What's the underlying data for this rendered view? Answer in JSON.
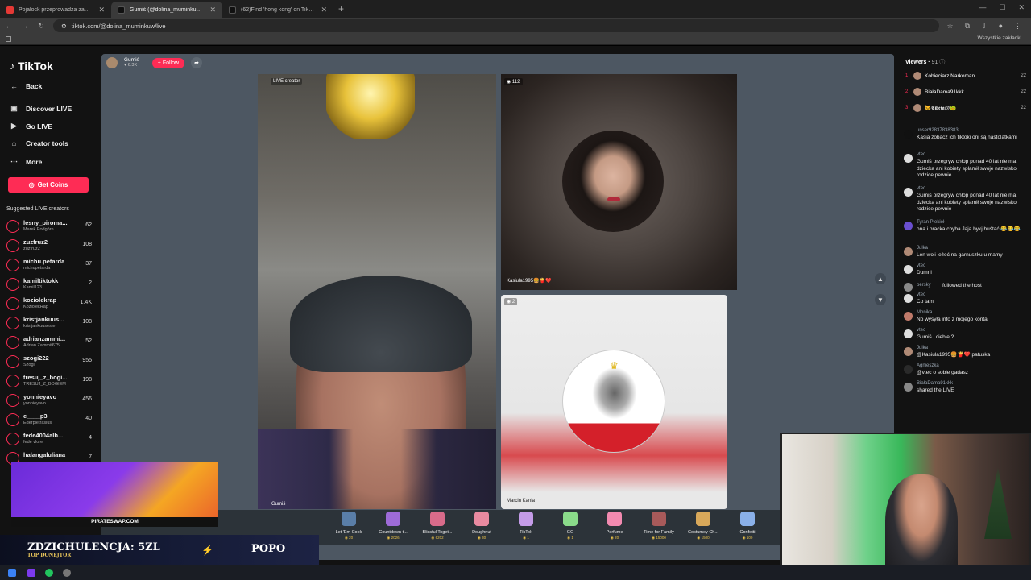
{
  "browser": {
    "tabs": [
      {
        "title": "Pojalock przeprowadza zamach",
        "color": "#e53935",
        "active": false
      },
      {
        "title": "Gumiś (@dolina_muminkuw) - TikTok LIVE",
        "color": "#111111",
        "active": true
      },
      {
        "title": "(62)Find 'hong kong' on TikTok",
        "color": "#111111",
        "active": false
      }
    ],
    "new_tab": "+",
    "url": "tiktok.com/@dolina_muminkuw/live",
    "all_bookmarks": "Wszystkie zakładki"
  },
  "sidebar": {
    "logo": "TikTok",
    "nav": [
      {
        "label": "Back",
        "icon": "back-arrow-icon",
        "glyph": "←"
      },
      {
        "label": "Discover LIVE",
        "icon": "live-tv-icon",
        "glyph": "▣"
      },
      {
        "label": "Go LIVE",
        "icon": "camera-icon",
        "glyph": "▶"
      },
      {
        "label": "Creator tools",
        "icon": "home-icon",
        "glyph": "⌂"
      },
      {
        "label": "More",
        "icon": "more-icon",
        "glyph": "⋯"
      }
    ],
    "get_coins": "Get Coins",
    "suggested_title": "Suggested LIVE creators",
    "creators": [
      {
        "name": "lesny_piroma...",
        "sub": "Marek Podgórn...",
        "count": "62"
      },
      {
        "name": "zuzfruz2",
        "sub": "zuzfruz2",
        "count": "108"
      },
      {
        "name": "michu.petarda",
        "sub": "michupetarda",
        "count": "37"
      },
      {
        "name": "kamiltiktokk",
        "sub": "Kamil123",
        "count": "2"
      },
      {
        "name": "koziolekrap",
        "sub": "KoziolekRap",
        "count": "1.4K"
      },
      {
        "name": "kristjankuus...",
        "sub": "kristjankuuseste",
        "count": "108"
      },
      {
        "name": "adrianzammi...",
        "sub": "Adrian Zammit675",
        "count": "52"
      },
      {
        "name": "szogi222",
        "sub": "Szogi",
        "count": "955"
      },
      {
        "name": "tresuj_z_bogi...",
        "sub": "TRESUJ_Z_BOGIEM",
        "count": "198"
      },
      {
        "name": "yonnieyavo",
        "sub": "yonnieyavo",
        "count": "456"
      },
      {
        "name": "e____p3",
        "sub": "Ederpietrasius",
        "count": "40"
      },
      {
        "name": "fede4004alb...",
        "sub": "fede vlore",
        "count": "4"
      },
      {
        "name": "halangaluliana",
        "sub": "",
        "count": "7"
      }
    ]
  },
  "host": {
    "name": "Gumiś",
    "likes": "6.3K",
    "follow_label": "+ Follow"
  },
  "videos": {
    "main_tag": "LIVE creator",
    "main_name": "Gumiś",
    "guest1_badge": "112",
    "guest1_name": "Kasiula1995🍔🍟❤️",
    "guest2_badge": "2",
    "guest2_name": "Marcin Kania"
  },
  "gifts": [
    {
      "name": "Let 'Em Cook",
      "price": "20",
      "color": "#5a7ea8"
    },
    {
      "name": "Countdown t...",
      "price": "2026",
      "color": "#9e6bd8"
    },
    {
      "name": "Blissful Toget...",
      "price": "6202",
      "color": "#d86b8a"
    },
    {
      "name": "Doughnut",
      "price": "30",
      "color": "#e88aa0"
    },
    {
      "name": "TikTok",
      "price": "1",
      "color": "#c49be8"
    },
    {
      "name": "GG",
      "price": "1",
      "color": "#8adb8a"
    },
    {
      "name": "Perfume",
      "price": "20",
      "color": "#f28ab0"
    },
    {
      "name": "Time for Family",
      "price": "15000",
      "color": "#a85a5a"
    },
    {
      "name": "Costumey Ch...",
      "price": "1500",
      "color": "#d8a85a"
    },
    {
      "name": "Confetti",
      "price": "100",
      "color": "#8ab0e8"
    }
  ],
  "viewers": {
    "title": "Viewers",
    "count": "91",
    "top": [
      {
        "rank": "1",
        "name": "Kobieciarz Narkoman",
        "score": "22"
      },
      {
        "rank": "2",
        "name": "BiałaDama91kkk",
        "score": "22"
      },
      {
        "rank": "3",
        "name": "🐱𝕮𝖜𝖊𝖎𝖆@🐸",
        "score": "22"
      }
    ]
  },
  "chat": [
    {
      "user": "unser92837838383",
      "text": "Kasia zobacz ich tiktoki oni są nastolatkami",
      "color": "#111111"
    },
    {
      "user": "vtec",
      "text": "Gumiś przegryw chłop ponad 40 lat nie ma dziecka ani kobiety splamił swoje nazwisko rodzice pewnie",
      "color": "#dddddd"
    },
    {
      "user": "vtec",
      "text": "Gumiś przegryw chłop ponad 40 lat nie ma dziecka ani kobiety splamił swoje nazwisko rodzice pewnie",
      "color": "#dddddd"
    },
    {
      "user": "Tyran Piekieł",
      "text": "ona i pracka chyba Jaja bykj huśtać 😂😂😂",
      "color": "#6a4fcf"
    },
    {
      "user": "Julka",
      "text": "Len woli leżeć na garnuszku u mamy",
      "color": "#b08a76"
    },
    {
      "user": "vtec",
      "text": "Dumni",
      "color": "#dddddd"
    },
    {
      "user": "pérsky",
      "text": "followed the host",
      "color": "#888888"
    },
    {
      "user": "vtec",
      "text": "Co tam",
      "color": "#dddddd"
    },
    {
      "user": "Monika",
      "text": "No wysyła info z mojego konta",
      "color": "#c07a6a"
    },
    {
      "user": "vtec",
      "text": "Gumiś i ciebie ?",
      "color": "#dddddd"
    },
    {
      "user": "Julka",
      "text": "@Kasiula1995🍔🍟❤️ patuska",
      "color": "#b08a76"
    },
    {
      "user": "Agnieszka",
      "text": "@vtec o sobie gadasz",
      "color": "#2a2a2a"
    },
    {
      "user": "BiałaDama91kkk",
      "text": "shared the LIVE",
      "color": "#888888"
    }
  ],
  "overlay": {
    "ad_text": "PIRATESWAP.COM",
    "donation_title": "ZDZICHULENCJA: 5ZL",
    "donation_sub": "TOP DONEJTOR",
    "donation_right": "POPO"
  }
}
